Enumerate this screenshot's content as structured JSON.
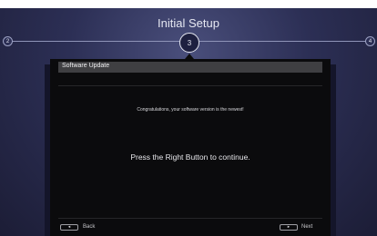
{
  "header": {
    "title": "Initial Setup"
  },
  "steps": {
    "previous": "2",
    "current": "3",
    "next": "4"
  },
  "panel": {
    "section_title": "Software Update",
    "message": "Congratulations, your software version is the newest!",
    "instruction": "Press the Right Button to continue."
  },
  "footer": {
    "back_key_icon": "◄",
    "back_label": "Back",
    "next_key_icon": "►",
    "next_label": "Next"
  },
  "colors": {
    "background": "#2c2f55",
    "panel": "#0b0b0d",
    "header_bar": "#3f3f42",
    "text": "#e6e8f2"
  }
}
